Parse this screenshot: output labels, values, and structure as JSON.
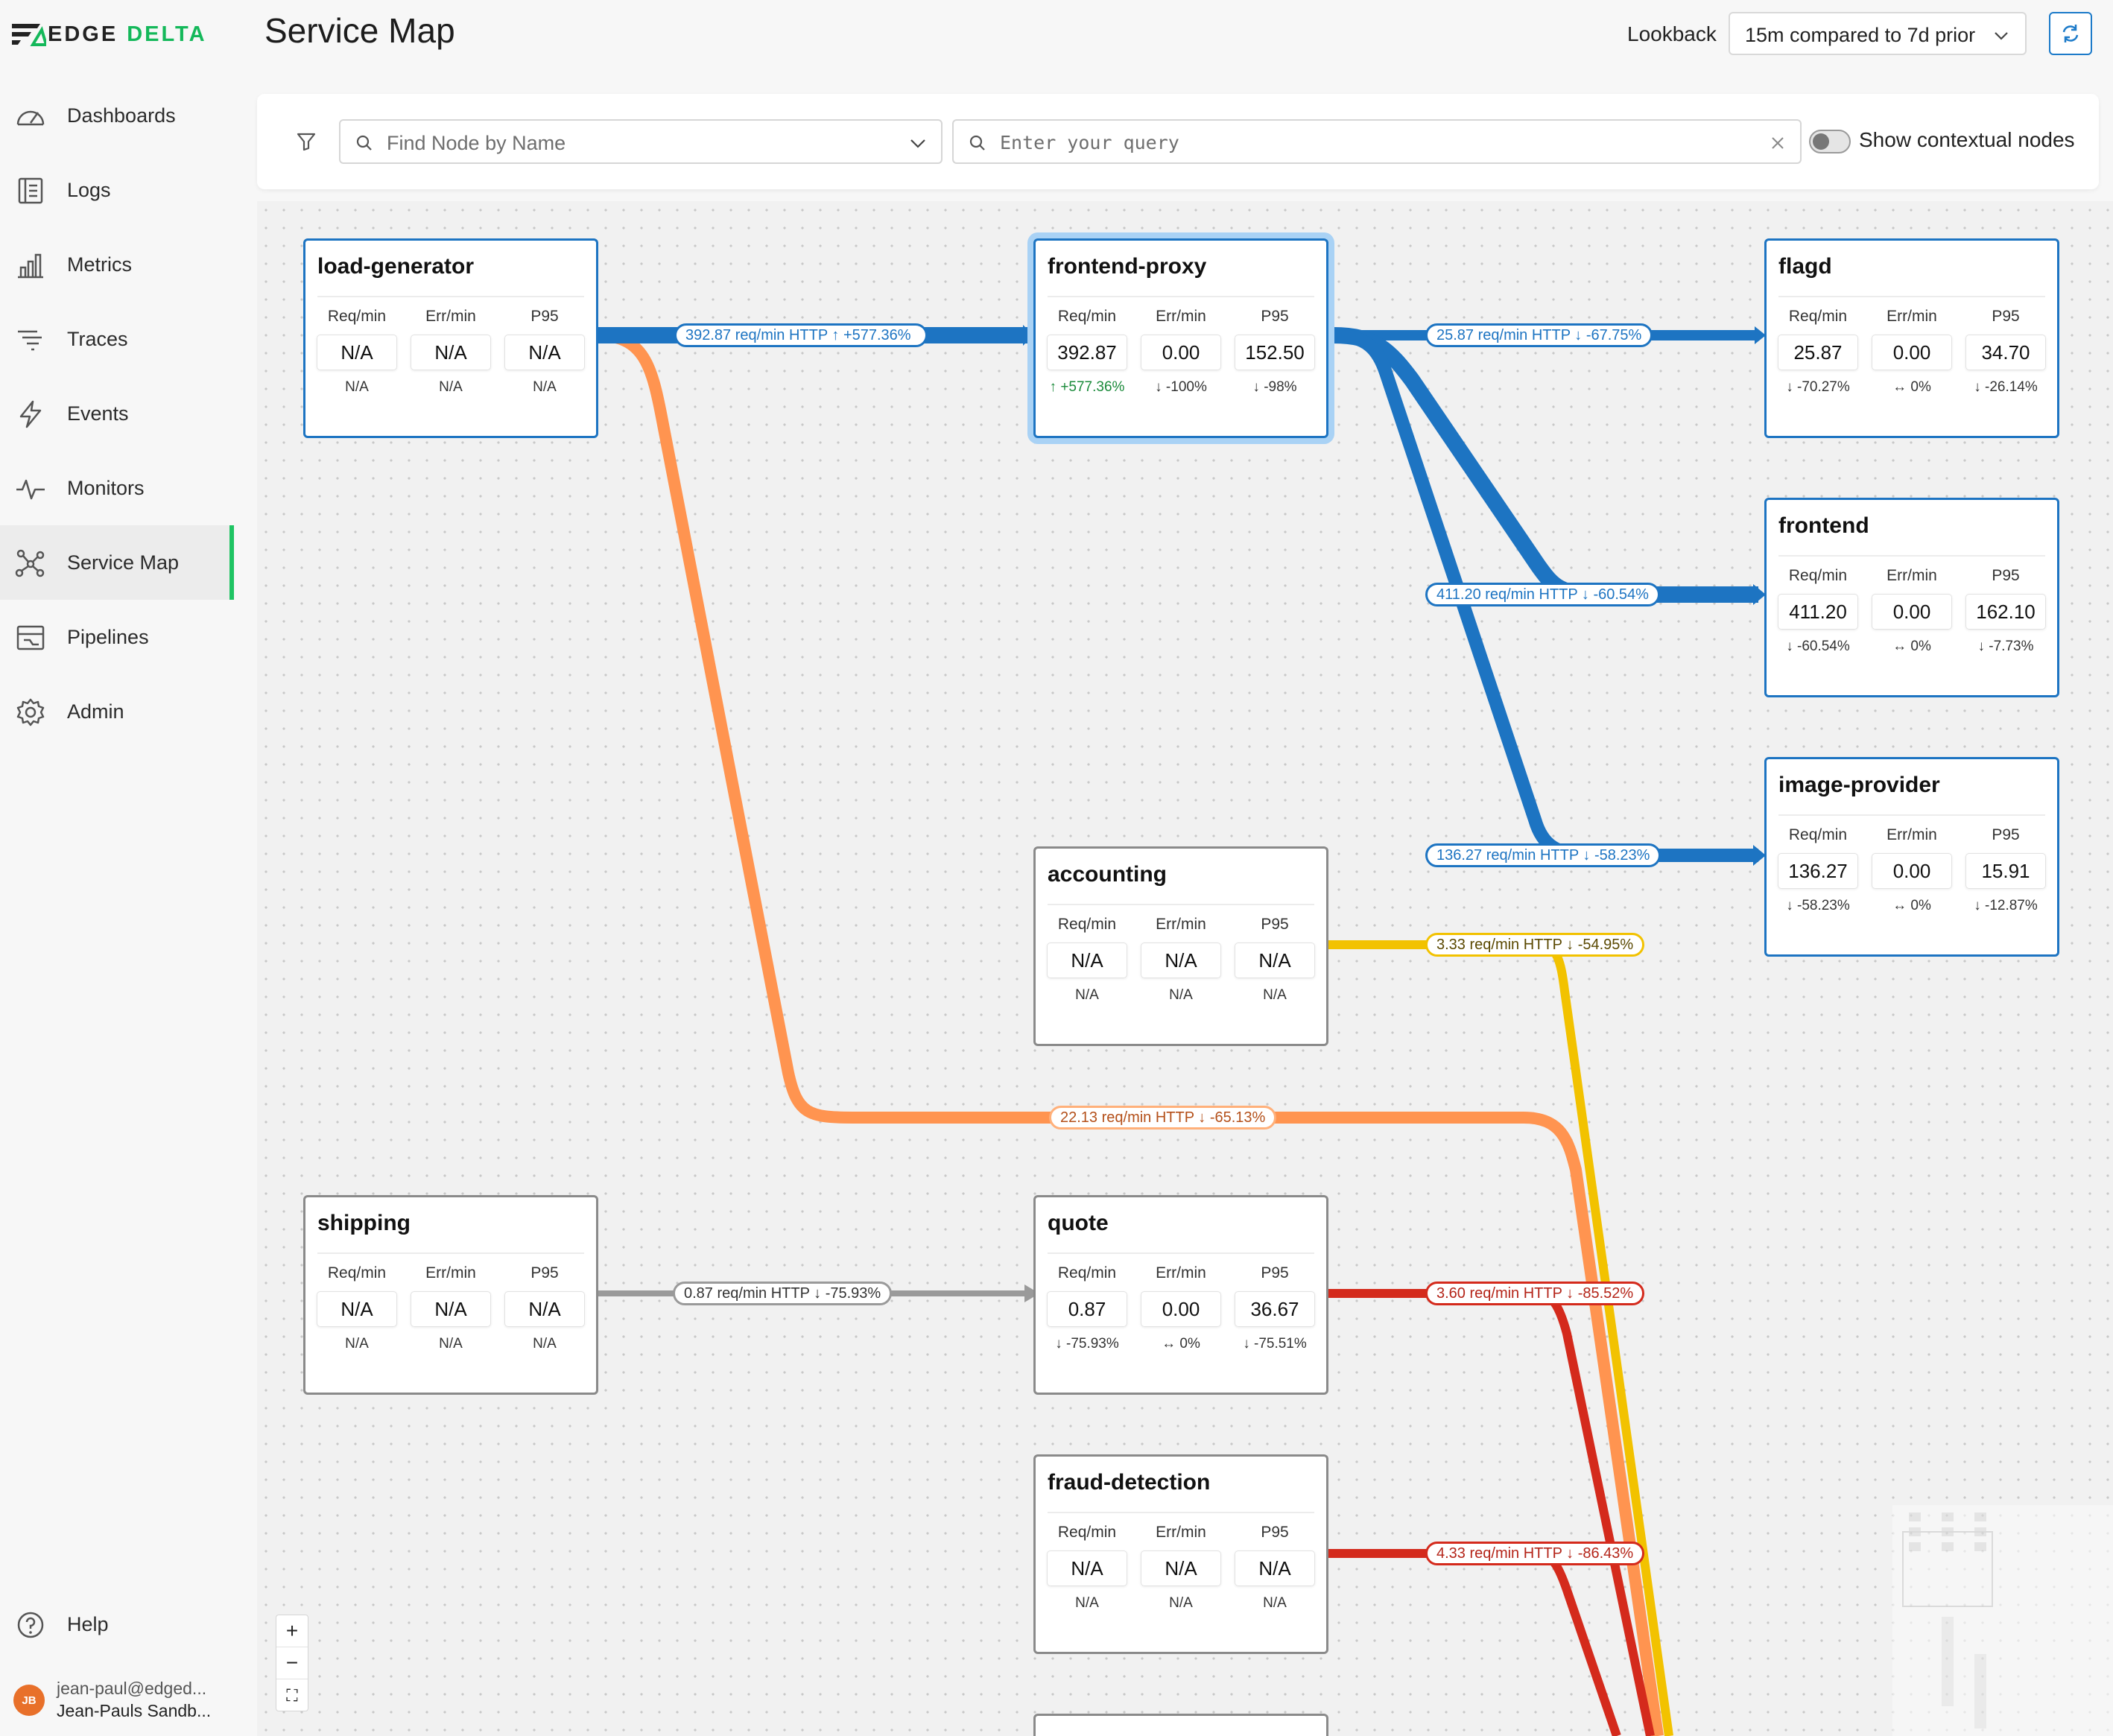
{
  "app": {
    "logo_word1": "EDGE",
    "logo_word2": "DELTA"
  },
  "sidebar": {
    "items": [
      {
        "label": "Dashboards",
        "icon": "gauge-icon"
      },
      {
        "label": "Logs",
        "icon": "logs-icon"
      },
      {
        "label": "Metrics",
        "icon": "bar-chart-icon"
      },
      {
        "label": "Traces",
        "icon": "traces-icon"
      },
      {
        "label": "Events",
        "icon": "lightning-icon"
      },
      {
        "label": "Monitors",
        "icon": "pulse-icon"
      },
      {
        "label": "Service Map",
        "icon": "network-icon",
        "active": true
      },
      {
        "label": "Pipelines",
        "icon": "pipelines-icon"
      },
      {
        "label": "Admin",
        "icon": "gear-icon"
      }
    ],
    "help": "Help",
    "user": {
      "initials": "JB",
      "email": "jean-paul@edged...",
      "org": "Jean-Pauls Sandb..."
    }
  },
  "header": {
    "title": "Service Map",
    "lookback_label": "Lookback",
    "lookback_value": "15m compared to 7d prior"
  },
  "filters": {
    "find_node_placeholder": "Find Node by Name",
    "query_placeholder": "Enter your query",
    "contextual_label": "Show contextual nodes",
    "contextual_on": false
  },
  "metric_headers": [
    "Req/min",
    "Err/min",
    "P95"
  ],
  "nodes": [
    {
      "name": "load-generator",
      "values": [
        "N/A",
        "N/A",
        "N/A"
      ],
      "deltas": [
        "N/A",
        "N/A",
        "N/A"
      ]
    },
    {
      "name": "frontend-proxy",
      "values": [
        "392.87",
        "0.00",
        "152.50"
      ],
      "deltas": [
        "↑ +577.36%",
        "↓ -100%",
        "↓ -98%"
      ],
      "selected": true
    },
    {
      "name": "flagd",
      "values": [
        "25.87",
        "0.00",
        "34.70"
      ],
      "deltas": [
        "↓ -70.27%",
        "↔ 0%",
        "↓ -26.14%"
      ]
    },
    {
      "name": "frontend",
      "values": [
        "411.20",
        "0.00",
        "162.10"
      ],
      "deltas": [
        "↓ -60.54%",
        "↔ 0%",
        "↓ -7.73%"
      ]
    },
    {
      "name": "image-provider",
      "values": [
        "136.27",
        "0.00",
        "15.91"
      ],
      "deltas": [
        "↓ -58.23%",
        "↔ 0%",
        "↓ -12.87%"
      ]
    },
    {
      "name": "accounting",
      "values": [
        "N/A",
        "N/A",
        "N/A"
      ],
      "deltas": [
        "N/A",
        "N/A",
        "N/A"
      ]
    },
    {
      "name": "shipping",
      "values": [
        "N/A",
        "N/A",
        "N/A"
      ],
      "deltas": [
        "N/A",
        "N/A",
        "N/A"
      ]
    },
    {
      "name": "quote",
      "values": [
        "0.87",
        "0.00",
        "36.67"
      ],
      "deltas": [
        "↓ -75.93%",
        "↔ 0%",
        "↓ -75.51%"
      ]
    },
    {
      "name": "fraud-detection",
      "values": [
        "N/A",
        "N/A",
        "N/A"
      ],
      "deltas": [
        "N/A",
        "N/A",
        "N/A"
      ]
    }
  ],
  "edges": [
    {
      "label": "392.87 req/min HTTP ↑ +577.36%",
      "color": "#1d74c2"
    },
    {
      "label": "25.87 req/min HTTP ↓ -67.75%",
      "color": "#1d74c2"
    },
    {
      "label": "411.20 req/min HTTP ↓ -60.54%",
      "color": "#1d74c2"
    },
    {
      "label": "136.27 req/min HTTP ↓ -58.23%",
      "color": "#1d74c2"
    },
    {
      "label": "3.33 req/min HTTP ↓ -54.95%",
      "color": "#f2c200"
    },
    {
      "label": "22.13 req/min HTTP ↓ -65.13%",
      "color": "#ff8c42"
    },
    {
      "label": "0.87 req/min HTTP ↓ -75.93%",
      "color": "#9a9a9a"
    },
    {
      "label": "3.60 req/min HTTP ↓ -85.52%",
      "color": "#d42a1c"
    },
    {
      "label": "4.33 req/min HTTP ↓ -86.43%",
      "color": "#d42a1c"
    }
  ],
  "zoom": {
    "in": "+",
    "out": "−",
    "fit": "⛶"
  },
  "colors": {
    "accent": "#1fc463",
    "blue": "#1d74c2",
    "orange": "#ff8c42",
    "yellow": "#f2c200",
    "red": "#d42a1c",
    "gray": "#9a9a9a"
  }
}
